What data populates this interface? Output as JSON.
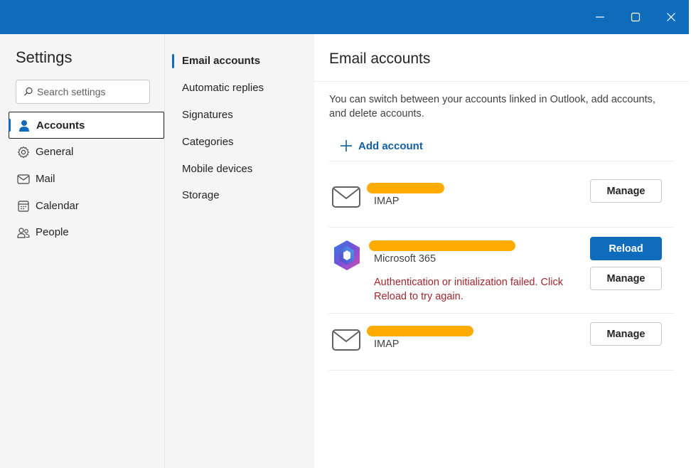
{
  "window": {
    "controls": [
      "minimize",
      "maximize",
      "close"
    ],
    "titlebar_color": "#0f6cbd"
  },
  "sidebar": {
    "title": "Settings",
    "search_placeholder": "Search settings",
    "items": [
      {
        "label": "Accounts",
        "icon": "person-icon",
        "active": true
      },
      {
        "label": "General",
        "icon": "gear-icon",
        "active": false
      },
      {
        "label": "Mail",
        "icon": "mail-icon",
        "active": false
      },
      {
        "label": "Calendar",
        "icon": "calendar-icon",
        "active": false
      },
      {
        "label": "People",
        "icon": "people-icon",
        "active": false
      }
    ]
  },
  "subnav": {
    "items": [
      {
        "label": "Email accounts",
        "active": true
      },
      {
        "label": "Automatic replies",
        "active": false
      },
      {
        "label": "Signatures",
        "active": false
      },
      {
        "label": "Categories",
        "active": false
      },
      {
        "label": "Mobile devices",
        "active": false
      },
      {
        "label": "Storage",
        "active": false
      }
    ]
  },
  "main": {
    "title": "Email accounts",
    "description": "You can switch between your accounts linked in Outlook, add accounts, and delete accounts.",
    "add_account_label": "Add account",
    "accounts": [
      {
        "type": "IMAP",
        "icon": "envelope-icon",
        "buttons": [
          "Manage"
        ]
      },
      {
        "type": "Microsoft 365",
        "icon": "microsoft-365-icon",
        "error": "Authentication or initialization failed. Click Reload to try again.",
        "buttons": [
          "Reload",
          "Manage"
        ]
      },
      {
        "type": "IMAP",
        "icon": "envelope-icon",
        "buttons": [
          "Manage"
        ]
      }
    ]
  },
  "colors": {
    "accent": "#0f6cbd",
    "error": "#a4262c",
    "redaction": "#ffab00"
  }
}
